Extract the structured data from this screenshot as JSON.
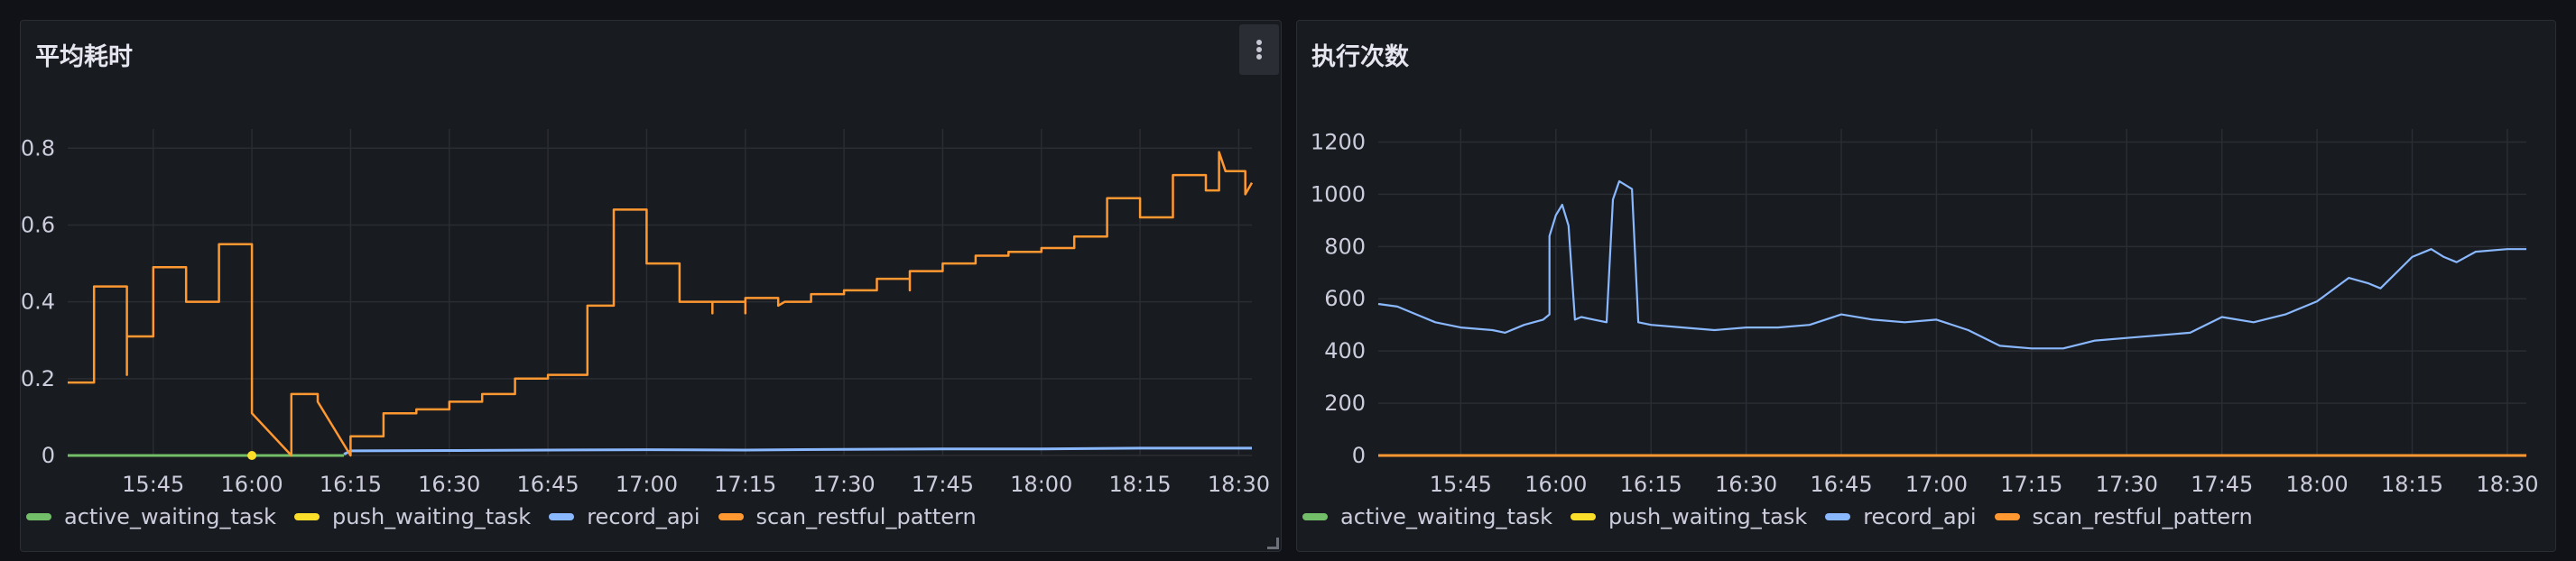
{
  "panels": [
    {
      "title": "平均耗时"
    },
    {
      "title": "执行次数"
    }
  ],
  "colors": {
    "active_waiting_task": "#73bf69",
    "push_waiting_task": "#fade2a",
    "record_api": "#8ab8ff",
    "scan_restful_pattern": "#ff9830"
  },
  "chart_data": [
    {
      "type": "line",
      "title": "平均耗时",
      "xlabel": "",
      "ylabel": "",
      "x_ticks": [
        "15:45",
        "16:00",
        "16:15",
        "16:30",
        "16:45",
        "17:00",
        "17:15",
        "17:30",
        "17:45",
        "18:00",
        "18:15",
        "18:30"
      ],
      "y_ticks": [
        "0",
        "0.2",
        "0.4",
        "0.6",
        "0.8"
      ],
      "xlim": [
        "15:32",
        "18:32"
      ],
      "ylim": [
        0,
        0.85
      ],
      "grid": true,
      "legend": "bottom-left",
      "series": [
        {
          "name": "active_waiting_task",
          "points": [
            [
              "15:32",
              0
            ],
            [
              "15:58",
              0
            ],
            [
              "16:09",
              0
            ],
            [
              "16:14",
              0
            ]
          ]
        },
        {
          "name": "push_waiting_task",
          "points": [
            [
              "16:00",
              0
            ]
          ]
        },
        {
          "name": "record_api",
          "points": [
            [
              "16:14",
              0.003
            ],
            [
              "16:15",
              0.012
            ],
            [
              "16:30",
              0.013
            ],
            [
              "16:45",
              0.014
            ],
            [
              "17:00",
              0.015
            ],
            [
              "17:15",
              0.014
            ],
            [
              "17:30",
              0.016
            ],
            [
              "17:45",
              0.017
            ],
            [
              "18:00",
              0.017
            ],
            [
              "18:15",
              0.019
            ],
            [
              "18:32",
              0.019
            ]
          ]
        },
        {
          "name": "scan_restful_pattern",
          "points": [
            [
              "15:32",
              0.19
            ],
            [
              "15:36",
              0.19
            ],
            [
              "15:36",
              0.44
            ],
            [
              "15:41",
              0.44
            ],
            [
              "15:41",
              0.21
            ],
            [
              "15:41",
              0.31
            ],
            [
              "15:45",
              0.31
            ],
            [
              "15:45",
              0.49
            ],
            [
              "15:50",
              0.49
            ],
            [
              "15:50",
              0.4
            ],
            [
              "15:55",
              0.4
            ],
            [
              "15:55",
              0.55
            ],
            [
              "16:00",
              0.55
            ],
            [
              "16:00",
              0.11
            ],
            [
              "16:06",
              0.0
            ],
            [
              "16:06",
              0.16
            ],
            [
              "16:10",
              0.16
            ],
            [
              "16:10",
              0.14
            ],
            [
              "16:15",
              0.0
            ],
            [
              "16:15",
              0.05
            ],
            [
              "16:20",
              0.05
            ],
            [
              "16:20",
              0.11
            ],
            [
              "16:25",
              0.11
            ],
            [
              "16:25",
              0.12
            ],
            [
              "16:30",
              0.12
            ],
            [
              "16:30",
              0.14
            ],
            [
              "16:35",
              0.14
            ],
            [
              "16:35",
              0.16
            ],
            [
              "16:40",
              0.16
            ],
            [
              "16:40",
              0.2
            ],
            [
              "16:45",
              0.2
            ],
            [
              "16:45",
              0.21
            ],
            [
              "16:51",
              0.21
            ],
            [
              "16:51",
              0.39
            ],
            [
              "16:55",
              0.39
            ],
            [
              "16:55",
              0.64
            ],
            [
              "17:00",
              0.64
            ],
            [
              "17:00",
              0.5
            ],
            [
              "17:05",
              0.5
            ],
            [
              "17:05",
              0.4
            ],
            [
              "17:10",
              0.4
            ],
            [
              "17:10",
              0.37
            ],
            [
              "17:10",
              0.4
            ],
            [
              "17:15",
              0.4
            ],
            [
              "17:15",
              0.37
            ],
            [
              "17:15",
              0.41
            ],
            [
              "17:20",
              0.41
            ],
            [
              "17:20",
              0.39
            ],
            [
              "17:21",
              0.4
            ],
            [
              "17:25",
              0.4
            ],
            [
              "17:25",
              0.42
            ],
            [
              "17:30",
              0.42
            ],
            [
              "17:30",
              0.43
            ],
            [
              "17:35",
              0.43
            ],
            [
              "17:35",
              0.46
            ],
            [
              "17:40",
              0.46
            ],
            [
              "17:40",
              0.43
            ],
            [
              "17:40",
              0.48
            ],
            [
              "17:45",
              0.48
            ],
            [
              "17:45",
              0.5
            ],
            [
              "17:50",
              0.5
            ],
            [
              "17:50",
              0.52
            ],
            [
              "17:55",
              0.52
            ],
            [
              "17:55",
              0.53
            ],
            [
              "18:00",
              0.53
            ],
            [
              "18:00",
              0.54
            ],
            [
              "18:05",
              0.54
            ],
            [
              "18:05",
              0.57
            ],
            [
              "18:10",
              0.57
            ],
            [
              "18:10",
              0.67
            ],
            [
              "18:15",
              0.67
            ],
            [
              "18:15",
              0.62
            ],
            [
              "18:20",
              0.62
            ],
            [
              "18:20",
              0.73
            ],
            [
              "18:25",
              0.73
            ],
            [
              "18:25",
              0.69
            ],
            [
              "18:27",
              0.69
            ],
            [
              "18:27",
              0.79
            ],
            [
              "18:28",
              0.74
            ],
            [
              "18:31",
              0.74
            ],
            [
              "18:31",
              0.68
            ],
            [
              "18:32",
              0.71
            ]
          ]
        }
      ]
    },
    {
      "type": "line",
      "title": "执行次数",
      "xlabel": "",
      "ylabel": "",
      "x_ticks": [
        "15:45",
        "16:00",
        "16:15",
        "16:30",
        "16:45",
        "17:00",
        "17:15",
        "17:30",
        "17:45",
        "18:00",
        "18:15",
        "18:30"
      ],
      "y_ticks": [
        "0",
        "200",
        "400",
        "600",
        "800",
        "1000",
        "1200"
      ],
      "xlim": [
        "15:32",
        "18:33"
      ],
      "ylim": [
        0,
        1250
      ],
      "grid": true,
      "legend": "bottom-left",
      "series": [
        {
          "name": "active_waiting_task",
          "points": [
            [
              "15:32",
              0
            ],
            [
              "18:33",
              0
            ]
          ]
        },
        {
          "name": "push_waiting_task",
          "points": [
            [
              "15:32",
              0
            ],
            [
              "18:33",
              0
            ]
          ]
        },
        {
          "name": "record_api",
          "points": [
            [
              "15:32",
              580
            ],
            [
              "15:35",
              570
            ],
            [
              "15:38",
              540
            ],
            [
              "15:41",
              510
            ],
            [
              "15:45",
              490
            ],
            [
              "15:50",
              480
            ],
            [
              "15:52",
              470
            ],
            [
              "15:55",
              500
            ],
            [
              "15:58",
              520
            ],
            [
              "15:59",
              540
            ],
            [
              "15:59",
              840
            ],
            [
              "16:00",
              920
            ],
            [
              "16:01",
              960
            ],
            [
              "16:02",
              880
            ],
            [
              "16:03",
              520
            ],
            [
              "16:04",
              530
            ],
            [
              "16:06",
              520
            ],
            [
              "16:08",
              510
            ],
            [
              "16:09",
              980
            ],
            [
              "16:10",
              1050
            ],
            [
              "16:12",
              1020
            ],
            [
              "16:13",
              510
            ],
            [
              "16:15",
              500
            ],
            [
              "16:20",
              490
            ],
            [
              "16:25",
              480
            ],
            [
              "16:30",
              490
            ],
            [
              "16:35",
              490
            ],
            [
              "16:40",
              500
            ],
            [
              "16:45",
              540
            ],
            [
              "16:50",
              520
            ],
            [
              "16:55",
              510
            ],
            [
              "17:00",
              520
            ],
            [
              "17:05",
              480
            ],
            [
              "17:10",
              420
            ],
            [
              "17:15",
              410
            ],
            [
              "17:20",
              410
            ],
            [
              "17:25",
              440
            ],
            [
              "17:30",
              450
            ],
            [
              "17:35",
              460
            ],
            [
              "17:40",
              470
            ],
            [
              "17:45",
              530
            ],
            [
              "17:50",
              510
            ],
            [
              "17:55",
              540
            ],
            [
              "18:00",
              590
            ],
            [
              "18:05",
              680
            ],
            [
              "18:08",
              660
            ],
            [
              "18:10",
              640
            ],
            [
              "18:15",
              760
            ],
            [
              "18:18",
              790
            ],
            [
              "18:20",
              760
            ],
            [
              "18:22",
              740
            ],
            [
              "18:25",
              780
            ],
            [
              "18:30",
              790
            ],
            [
              "18:33",
              790
            ]
          ]
        },
        {
          "name": "scan_restful_pattern",
          "points": [
            [
              "15:32",
              0
            ],
            [
              "18:33",
              0
            ]
          ]
        }
      ]
    }
  ]
}
